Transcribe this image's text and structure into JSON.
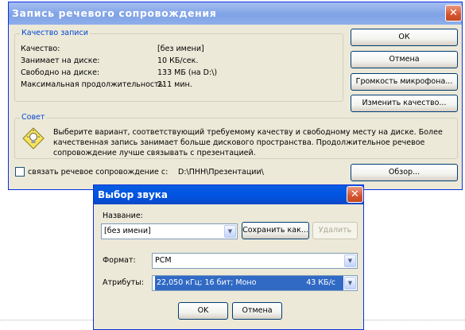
{
  "main_dialog": {
    "title": "Запись речевого сопровождения",
    "quality_group": {
      "title": "Качество записи",
      "rows": [
        {
          "label": "Качество:",
          "value": "[без имени]"
        },
        {
          "label": "Занимает на диске:",
          "value": "10 КБ/сек."
        },
        {
          "label": "Свободно на диске:",
          "value": "133 МБ (на D:\\)"
        },
        {
          "label": "Максимальная продолжительность:",
          "value": "211 мин."
        }
      ]
    },
    "buttons": {
      "ok": "ОК",
      "cancel": "Отмена",
      "mic_volume": "Громкость микрофона...",
      "change_quality": "Изменить качество..."
    },
    "tip_group": {
      "title": "Совет",
      "lines": [
        "Выберите вариант, соответствующий требуемому качеству и свободному месту на диске. Более",
        "качественная запись занимает больше дискового пространства. Продолжительное речевое",
        "сопровождение лучше связывать с презентацией."
      ]
    },
    "link": {
      "checkbox_label": "связать речевое сопровождение с:",
      "path": "D:\\ПНН\\Презентации\\",
      "browse": "Обзор..."
    }
  },
  "sound_dialog": {
    "title": "Выбор звука",
    "name_label": "Название:",
    "name_value": "[без имени]",
    "save_as": "Сохранить как...",
    "delete": "Удалить",
    "format_label": "Формат:",
    "format_value": "PCM",
    "attributes_label": "Атрибуты:",
    "attributes_value": "22,050 кГц; 16 бит; Моно",
    "attributes_rate": "43 КБ/с",
    "ok": "OK",
    "cancel": "Отмена"
  },
  "colors": {
    "title_bar_main": "#8eaeea",
    "title_bar_sound": "#0054e3",
    "group_title": "#0046d5",
    "selection": "#316ac5",
    "close_button": "#d5532d"
  },
  "icons": [
    "close-icon",
    "lightbulb-hint-icon",
    "dropdown-arrow-icon"
  ]
}
